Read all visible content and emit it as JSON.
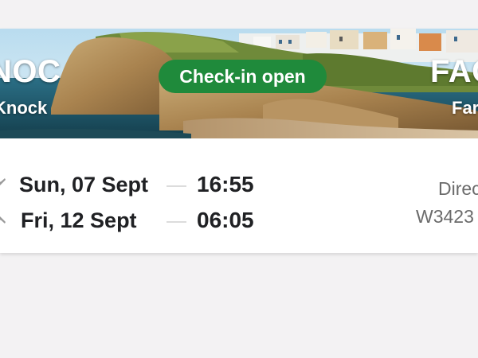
{
  "flight_card": {
    "origin": {
      "code": "NOC",
      "city": "Knock"
    },
    "destination": {
      "code": "FAO",
      "city": "Faro"
    },
    "status_badge": "Check-in open",
    "outbound": {
      "date": "Sun, 07 Sept",
      "time": "16:55"
    },
    "return": {
      "date": "Fri, 12 Sept",
      "time": "06:05"
    },
    "flight_type": "Direct",
    "flight_number": "W3423"
  },
  "colors": {
    "badge_green": "#1f8a3b",
    "text_primary": "#202124",
    "text_secondary": "#6b6b6b",
    "background": "#f3f2f3"
  },
  "icons": {
    "outbound": "plane-takeoff-icon",
    "return": "plane-landing-icon"
  }
}
